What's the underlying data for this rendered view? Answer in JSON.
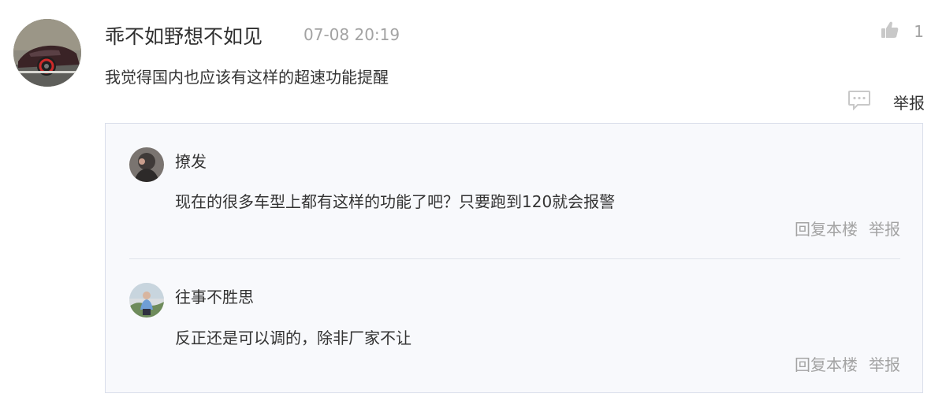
{
  "comment": {
    "username": "乖不如野想不如见",
    "timestamp": "07-08 20:19",
    "like_count": "1",
    "text": "我觉得国内也应该有这样的超速功能提醒",
    "report_label": "举报"
  },
  "replies": [
    {
      "username": "撩发",
      "text": "现在的很多车型上都有这样的功能了吧？只要跑到120就会报警",
      "reply_label": "回复本楼",
      "report_label": "举报"
    },
    {
      "username": "往事不胜思",
      "text": "反正还是可以调的，除非厂家不让",
      "reply_label": "回复本楼",
      "report_label": "举报"
    }
  ],
  "icons": {
    "like": "thumbs-up-icon",
    "comment": "comment-bubble-icon"
  },
  "colors": {
    "muted": "#a3a3a3",
    "reply_box_bg": "#f8f9fc",
    "reply_box_border": "#d9deea"
  }
}
